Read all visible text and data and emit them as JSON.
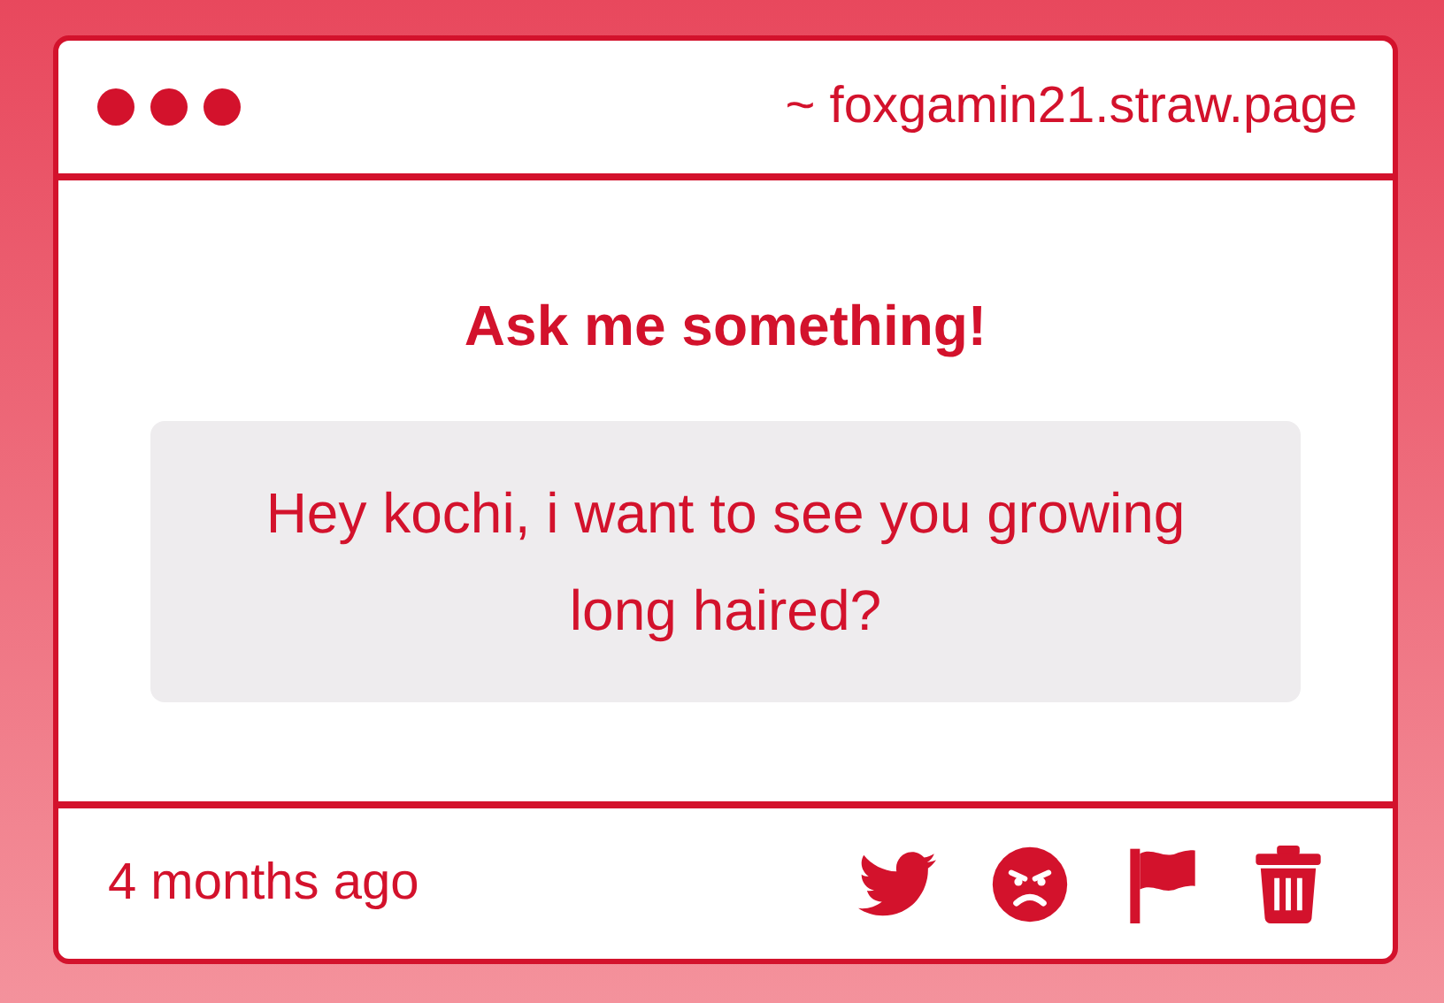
{
  "window": {
    "address": "~ foxgamin21.straw.page"
  },
  "prompt": {
    "title": "Ask me something!"
  },
  "question": {
    "text": "Hey kochi, i want to see you growing long haired?"
  },
  "footer": {
    "time": "4 months ago"
  }
}
